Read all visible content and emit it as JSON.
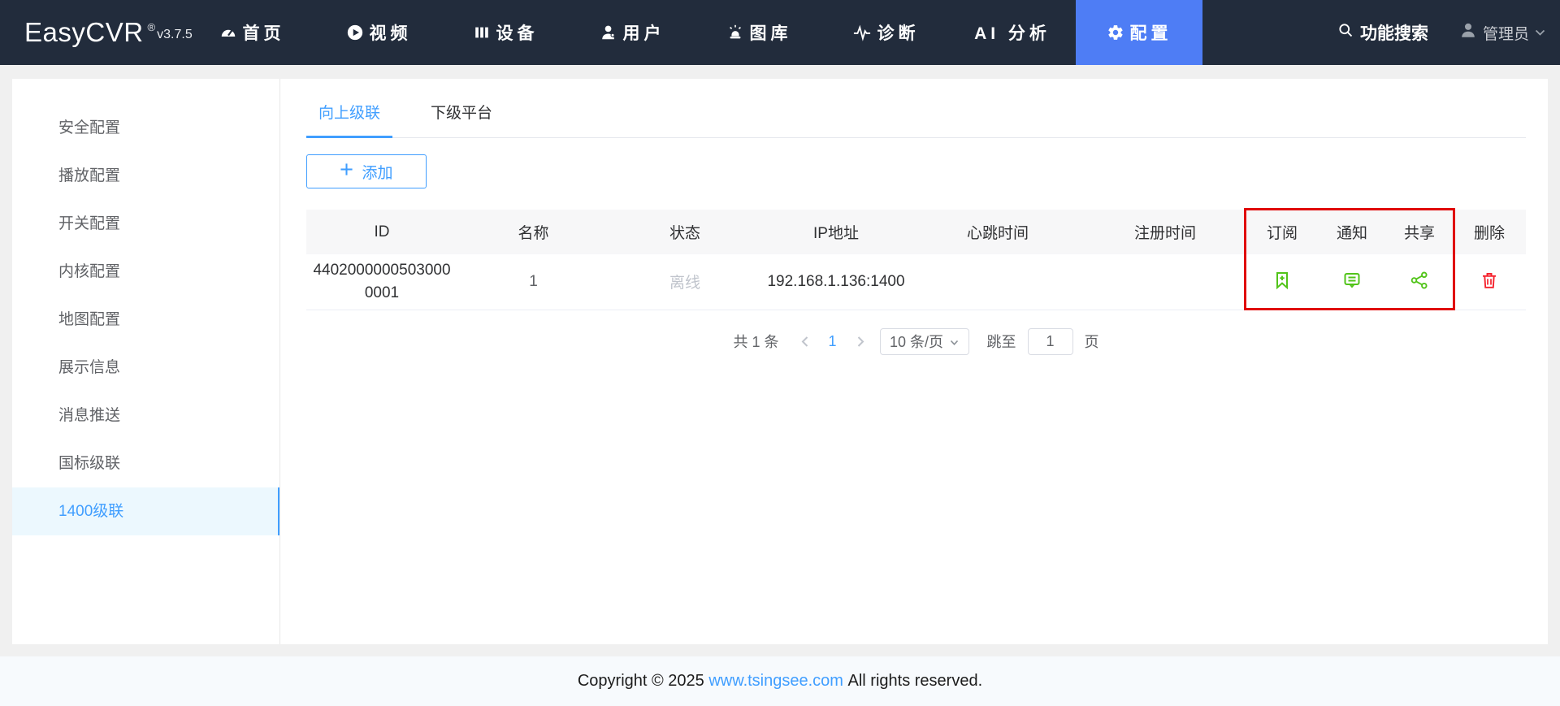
{
  "navbar": {
    "logo": "EasyCVR",
    "logo_reg": "®",
    "version": "v3.7.5",
    "items": [
      {
        "label": "首页",
        "icon": "dashboard-icon",
        "active": false
      },
      {
        "label": "视频",
        "icon": "video-icon",
        "active": false
      },
      {
        "label": "设备",
        "icon": "device-icon",
        "active": false
      },
      {
        "label": "用户",
        "icon": "user-icon",
        "active": false
      },
      {
        "label": "图库",
        "icon": "gallery-icon",
        "active": false
      },
      {
        "label": "诊断",
        "icon": "diagnosis-icon",
        "active": false
      },
      {
        "label": "AI 分析",
        "icon": "none",
        "active": false
      },
      {
        "label": "配置",
        "icon": "gear-icon",
        "active": true
      }
    ],
    "search_label": "功能搜索",
    "user_label": "管理员"
  },
  "sidebar": {
    "items": [
      {
        "label": "安全配置",
        "active": false
      },
      {
        "label": "播放配置",
        "active": false
      },
      {
        "label": "开关配置",
        "active": false
      },
      {
        "label": "内核配置",
        "active": false
      },
      {
        "label": "地图配置",
        "active": false
      },
      {
        "label": "展示信息",
        "active": false
      },
      {
        "label": "消息推送",
        "active": false
      },
      {
        "label": "国标级联",
        "active": false
      },
      {
        "label": "1400级联",
        "active": true
      }
    ]
  },
  "main": {
    "tabs": [
      {
        "label": "向上级联",
        "active": true
      },
      {
        "label": "下级平台",
        "active": false
      }
    ],
    "add_button_label": "添加",
    "table": {
      "columns": [
        "ID",
        "名称",
        "状态",
        "IP地址",
        "心跳时间",
        "注册时间",
        "订阅",
        "通知",
        "共享",
        "删除"
      ],
      "rows": [
        {
          "id": "44020000005030000001",
          "name": "1",
          "status": "离线",
          "ip": "192.168.1.136:1400",
          "heartbeat": "",
          "register_time": "",
          "action_icons": {
            "subscribe": "bookmark-plus-icon",
            "notify": "comment-icon",
            "share": "share-nodes-icon",
            "delete": "trash-icon"
          }
        }
      ],
      "annotation": "red box highlighting 订阅 / 通知 / 共享 columns"
    },
    "pagination": {
      "total": "共 1 条",
      "current_page": "1",
      "page_size": "10 条/页",
      "jump_label": "跳至",
      "jump_value": "1",
      "page_suffix": "页"
    }
  },
  "footer": {
    "prefix": "Copyright © 2025 ",
    "link": "www.tsingsee.com",
    "suffix": " All rights reserved."
  },
  "colors": {
    "navbar_bg": "#222c3c",
    "navbar_active_bg": "#4e7df5",
    "accent_blue": "#409eff",
    "sidebar_active_bg": "#ecf8fe",
    "table_header_bg": "#f7f7f8",
    "success_green": "#52c41a",
    "danger_red": "#f5222d",
    "annotation_red": "#e00000",
    "offline_gray": "#c0c4cc",
    "footer_bg": "#f7fafd"
  }
}
